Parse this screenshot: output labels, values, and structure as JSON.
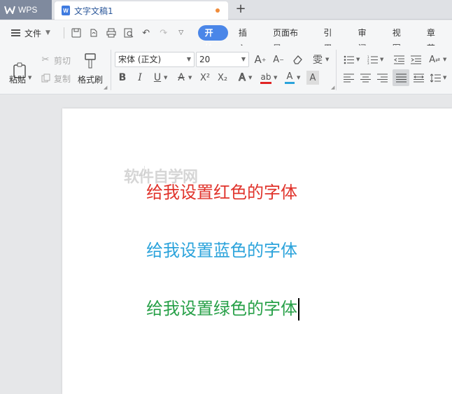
{
  "titlebar": {
    "app_tab": "WPS",
    "doc_tab": "文字文稿1",
    "doc_icon_letter": "W",
    "new_tab": "+"
  },
  "menubar": {
    "file": "文件",
    "tabs": [
      "开始",
      "插入",
      "页面布局",
      "引用",
      "审阅",
      "视图",
      "章节"
    ],
    "active_tab": "开始"
  },
  "ribbon": {
    "paste": "粘贴",
    "cut": "剪切",
    "copy": "复制",
    "format_painter": "格式刷",
    "font_name": "宋体 (正文)",
    "font_size": "20",
    "bold": "B",
    "italic": "I",
    "underline": "U",
    "strikethrough": "A",
    "superscript": "X²",
    "subscript": "X₂",
    "phonetic": "雯",
    "font_color_letter": "A",
    "highlight_letter": "ab"
  },
  "colors": {
    "accent": "#4a86e8",
    "red_text": "#e0332b",
    "blue_text": "#2ba3db",
    "green_text": "#27a048"
  },
  "document": {
    "watermark": "软件自学网",
    "lines": [
      {
        "text": "给我设置红色的字体",
        "color": "#e0332b"
      },
      {
        "text": "给我设置蓝色的字体",
        "color": "#2ba3db"
      },
      {
        "text": "给我设置绿色的字体",
        "color": "#27a048"
      }
    ]
  }
}
